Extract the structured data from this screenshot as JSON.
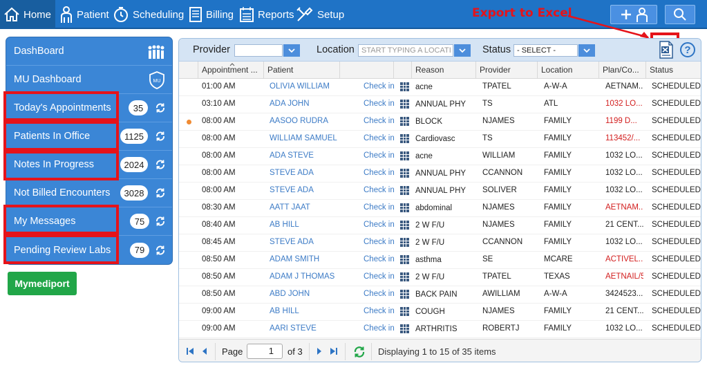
{
  "nav": {
    "home": "Home",
    "patient": "Patient",
    "scheduling": "Scheduling",
    "billing": "Billing",
    "reports": "Reports",
    "setup": "Setup"
  },
  "annotation": {
    "export_label": "Export to Excel"
  },
  "sidebar": {
    "items": [
      {
        "label": "DashBoard",
        "icon": "group-icon"
      },
      {
        "label": "MU Dashboard",
        "icon": "mu-shield-icon",
        "badge": "MU"
      },
      {
        "label": "Today's Appointments",
        "count": "35"
      },
      {
        "label": "Patients In Office",
        "count": "1125"
      },
      {
        "label": "Notes In Progress",
        "count": "2024"
      },
      {
        "label": "Not Billed Encounters",
        "count": "3028"
      },
      {
        "label": "My Messages",
        "count": "75"
      },
      {
        "label": "Pending Review Labs",
        "count": "79"
      }
    ],
    "mymediport": "Mymediport"
  },
  "filters": {
    "provider_label": "Provider",
    "provider_value": "",
    "location_label": "Location",
    "location_placeholder": "START TYPING A LOCATI",
    "status_label": "Status",
    "status_value": "- SELECT -"
  },
  "grid": {
    "columns": [
      "Appointment ...",
      "Patient",
      "",
      "",
      "Reason",
      "Provider",
      "Location",
      "Plan/Co...",
      "Status"
    ],
    "rows": [
      {
        "time": "01:00 AM",
        "patient": "OLIVIA WILLIAM",
        "checkin": "Check in",
        "reason": "acne",
        "provider": "TPATEL",
        "location": "A-W-A",
        "plan": "AETNAM...",
        "plan_red": false,
        "status": "SCHEDULED",
        "dot": false
      },
      {
        "time": "03:10 AM",
        "patient": "ADA JOHN",
        "checkin": "Check in",
        "reason": "ANNUAL PHY",
        "provider": "TS",
        "location": "ATL",
        "plan": "1032 LO...",
        "plan_red": true,
        "status": "SCHEDULED",
        "dot": false
      },
      {
        "time": "08:00 AM",
        "patient": "AASOO RUDRA",
        "checkin": "Check in",
        "reason": "BLOCK",
        "provider": "NJAMES",
        "location": "FAMILY",
        "plan": "1199 D...",
        "plan_red": true,
        "status": "SCHEDULED",
        "dot": true
      },
      {
        "time": "08:00 AM",
        "patient": "WILLIAM SAMUEL",
        "checkin": "Check in",
        "reason": "Cardiovasc",
        "provider": "TS",
        "location": "FAMILY",
        "plan": "113452/...",
        "plan_red": true,
        "status": "SCHEDULED",
        "dot": false
      },
      {
        "time": "08:00 AM",
        "patient": "ADA STEVE",
        "checkin": "Check in",
        "reason": "acne",
        "provider": "WILLIAM",
        "location": "FAMILY",
        "plan": "1032 LO...",
        "plan_red": false,
        "status": "SCHEDULED",
        "dot": false
      },
      {
        "time": "08:00 AM",
        "patient": "STEVE ADA",
        "checkin": "Check in",
        "reason": "ANNUAL PHY",
        "provider": "CCANNON",
        "location": "FAMILY",
        "plan": "1032 LO...",
        "plan_red": false,
        "status": "SCHEDULED",
        "dot": false
      },
      {
        "time": "08:00 AM",
        "patient": "STEVE ADA",
        "checkin": "Check in",
        "reason": "ANNUAL PHY",
        "provider": "SOLIVER",
        "location": "FAMILY",
        "plan": "1032 LO...",
        "plan_red": false,
        "status": "SCHEDULED",
        "dot": false
      },
      {
        "time": "08:30 AM",
        "patient": "AATT JAAT",
        "checkin": "Check in",
        "reason": "abdominal",
        "provider": "NJAMES",
        "location": "FAMILY",
        "plan": "AETNAM...",
        "plan_red": true,
        "status": "SCHEDULED",
        "dot": false
      },
      {
        "time": "08:40 AM",
        "patient": "AB HILL",
        "checkin": "Check in",
        "reason": "2 W F/U",
        "provider": "NJAMES",
        "location": "FAMILY",
        "plan": "21 CENT...",
        "plan_red": false,
        "status": "SCHEDULED",
        "dot": false
      },
      {
        "time": "08:45 AM",
        "patient": "STEVE ADA",
        "checkin": "Check in",
        "reason": "2 W F/U",
        "provider": "CCANNON",
        "location": "FAMILY",
        "plan": "1032 LO...",
        "plan_red": false,
        "status": "SCHEDULED",
        "dot": false
      },
      {
        "time": "08:50 AM",
        "patient": "ADAM SMITH",
        "checkin": "Check in",
        "reason": "asthma",
        "provider": "SE",
        "location": "MCARE",
        "plan": "ACTIVEL...",
        "plan_red": true,
        "status": "SCHEDULED",
        "dot": false
      },
      {
        "time": "08:50 AM",
        "patient": "ADAM J THOMAS",
        "checkin": "Check in",
        "reason": "2 W F/U",
        "provider": "TPATEL",
        "location": "TEXAS",
        "plan": "AETNAIL/5",
        "plan_red": true,
        "status": "SCHEDULED",
        "dot": false
      },
      {
        "time": "08:50 AM",
        "patient": "ABD JOHN",
        "checkin": "Check in",
        "reason": "BACK PAIN",
        "provider": "AWILLIAM",
        "location": "A-W-A",
        "plan": "3424523...",
        "plan_red": false,
        "status": "SCHEDULED",
        "dot": false
      },
      {
        "time": "09:00 AM",
        "patient": "AB HILL",
        "checkin": "Check in",
        "reason": "COUGH",
        "provider": "NJAMES",
        "location": "FAMILY",
        "plan": "21 CENT...",
        "plan_red": false,
        "status": "SCHEDULED",
        "dot": false
      },
      {
        "time": "09:00 AM",
        "patient": "AARI STEVE",
        "checkin": "Check in",
        "reason": "ARTHRITIS",
        "provider": "ROBERTJ",
        "location": "FAMILY",
        "plan": "1032 LO...",
        "plan_red": false,
        "status": "SCHEDULED",
        "dot": false
      }
    ]
  },
  "pager": {
    "page_label": "Page",
    "page_value": "1",
    "of_label": "of 3",
    "display": "Displaying 1 to 15 of 35 items"
  },
  "colors": {
    "nav_bg": "#1f73c6",
    "sidebar_bg": "#3b86d6",
    "highlight": "#e5131a",
    "link": "#3c7bc6",
    "plan_red": "#d21d1d",
    "mymediport": "#21a648"
  }
}
